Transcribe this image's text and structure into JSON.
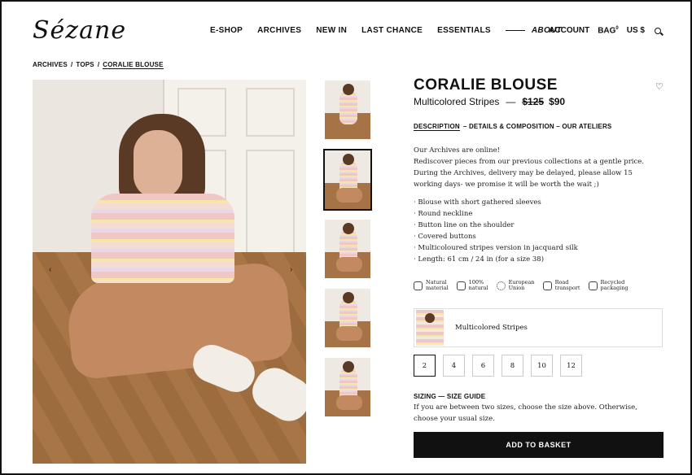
{
  "brand": {
    "logo": "Sézane"
  },
  "nav": {
    "items": [
      "E-SHOP",
      "ARCHIVES",
      "NEW IN",
      "LAST CHANCE",
      "ESSENTIALS"
    ],
    "about": "ABOUT"
  },
  "utilities": {
    "account": "ACCOUNT",
    "bag": "BAG",
    "bag_count": "0",
    "currency": "US $"
  },
  "breadcrumb": [
    "ARCHIVES",
    "TOPS",
    "CORALIE BLOUSE"
  ],
  "breadcrumb_sep": "/",
  "product": {
    "title": "CORALIE BLOUSE",
    "color": "Multicolored Stripes",
    "dash": "—",
    "old_price": "$125",
    "price": "$90"
  },
  "tabs": {
    "description": "DESCRIPTION",
    "rest": "– DETAILS & COMPOSITION – OUR ATELIERS"
  },
  "description": {
    "line1": "Our Archives are online!",
    "line2": "Rediscover pieces from our previous collections at a gentle price. During the Archives, delivery may be delayed, please allow 15 working days- we promise it will be worth the wait ;)"
  },
  "bullets": [
    "Blouse with short gathered sleeves",
    "Round neckline",
    "Button line on the shoulder",
    "Covered buttons",
    "Multicoloured stripes version in jacquard silk",
    "Length: 61 cm / 24 in (for a size 38)"
  ],
  "features": [
    {
      "icon": "leaf-icon",
      "l1": "Natural",
      "l2": "material"
    },
    {
      "icon": "leaf-icon",
      "l1": "100%",
      "l2": "natural"
    },
    {
      "icon": "europe-circle-icon",
      "l1": "European",
      "l2": "Union"
    },
    {
      "icon": "truck-icon",
      "l1": "Road",
      "l2": "transport"
    },
    {
      "icon": "tag-icon",
      "l1": "Recycled",
      "l2": "packaging"
    }
  ],
  "color_option": "Multicolored Stripes",
  "sizes": [
    "2",
    "4",
    "6",
    "8",
    "10",
    "12"
  ],
  "selected_size": "2",
  "sizing": {
    "heading": "SIZING — SIZE GUIDE",
    "text": "If you are between two sizes, choose the size above. Otherwise, choose your usual size."
  },
  "basket_label": "ADD TO BASKET",
  "icons": {
    "prev": "‹",
    "next": "›",
    "heart": "♡"
  }
}
